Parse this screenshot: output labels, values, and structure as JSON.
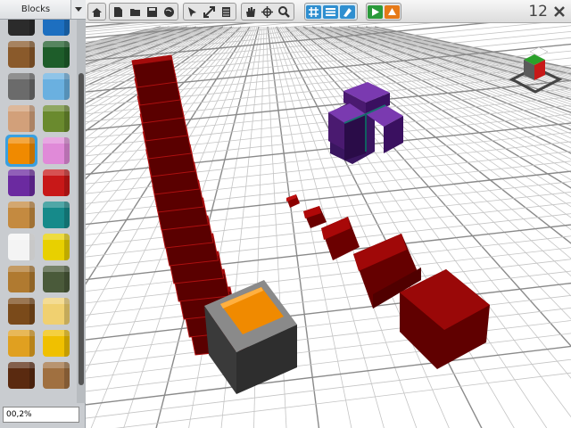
{
  "sidebar": {
    "category_label": "Blocks",
    "status_value": "00,2%",
    "palette": [
      {
        "left": "#2b2b2b",
        "right": "#1d6fc0"
      },
      {
        "left": "#8a5a2b",
        "right": "#1e5d2a"
      },
      {
        "left": "#6b6b6b",
        "right": "#6ab0e0"
      },
      {
        "left": "#d2a07a",
        "right": "#6a8a2e"
      },
      {
        "left": "#f08a00",
        "right": "#e08ad8"
      },
      {
        "left": "#6b2aa0",
        "right": "#c81818"
      },
      {
        "left": "#c48a40",
        "right": "#168a8a"
      },
      {
        "left": "#f4f4f4",
        "right": "#e8d000"
      },
      {
        "left": "#b07a30",
        "right": "#4a5a3a"
      },
      {
        "left": "#7a4a1a",
        "right": "#f0d070"
      },
      {
        "left": "#e0a020",
        "right": "#f0c000"
      },
      {
        "left": "#5a2a10",
        "right": "#a07040"
      }
    ],
    "selected_index": 4
  },
  "toolbar": {
    "counter": "12",
    "groups": [
      {
        "icons": [
          "home-icon"
        ]
      },
      {
        "icons": [
          "new-file-icon",
          "open-folder-icon",
          "save-icon",
          "globe-icon"
        ]
      },
      {
        "icons": [
          "select-arrow-icon",
          "resize-icon",
          "layers-icon"
        ]
      },
      {
        "icons": [
          "hand-icon",
          "move-icon",
          "zoom-icon"
        ]
      },
      {
        "icons": [
          "grid-icon",
          "list-icon",
          "paint-icon"
        ]
      },
      {
        "icons": [
          "play-icon",
          "up-arrow-icon"
        ]
      }
    ]
  },
  "colors": {
    "accent": "#3aa0e0",
    "red_block": "#8b0000",
    "orange": "#f08a00",
    "purple": "#6b2aa0"
  }
}
